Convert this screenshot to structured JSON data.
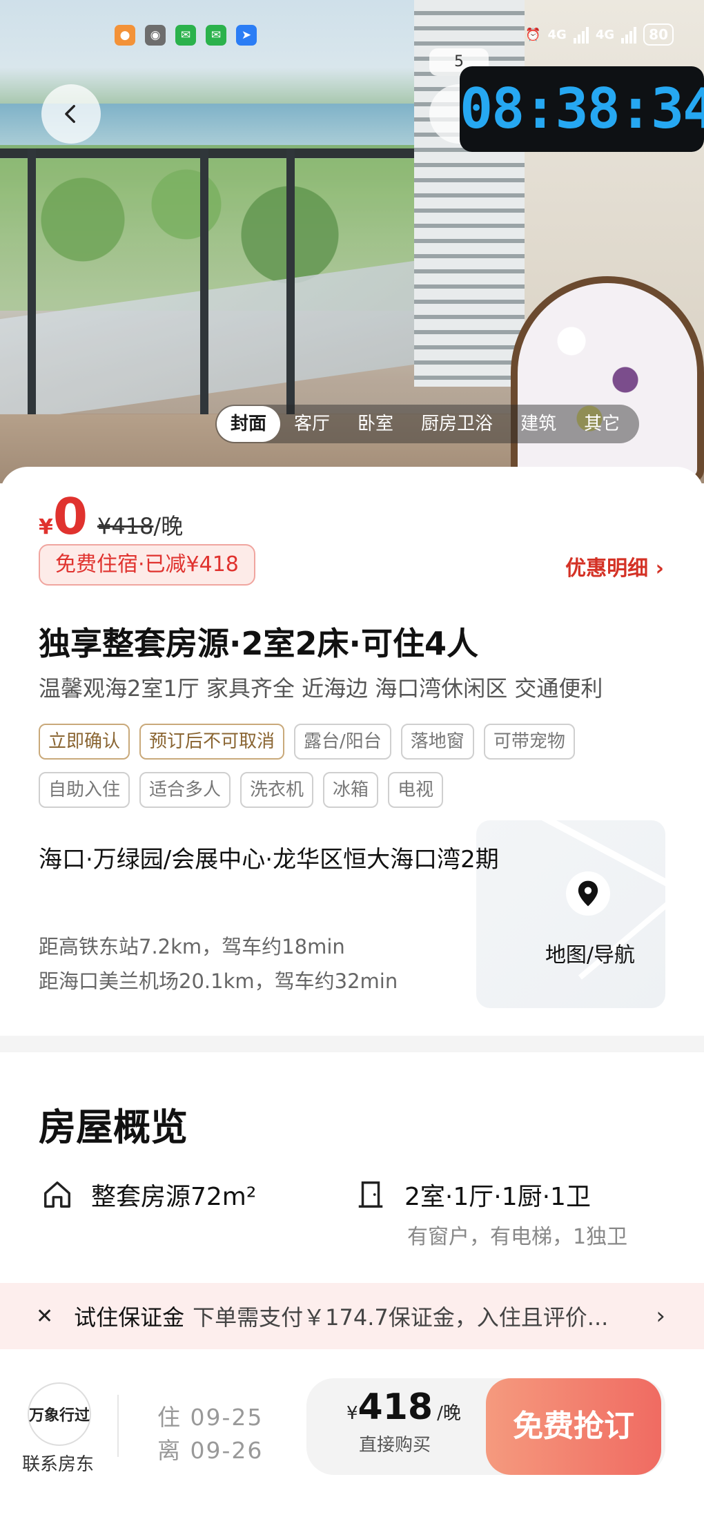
{
  "status_bar": {
    "apps": [
      {
        "name": "app-orange-icon",
        "color": "#f39238",
        "glyph": "●"
      },
      {
        "name": "camera-app-icon",
        "color": "#6d6d6d",
        "glyph": "◉"
      },
      {
        "name": "wechat-icon",
        "color": "#2bb24c",
        "glyph": "✉"
      },
      {
        "name": "wechat-icon-2",
        "color": "#2bb24c",
        "glyph": "✉"
      },
      {
        "name": "location-app-icon",
        "color": "#2b7df5",
        "glyph": "➤"
      }
    ],
    "network_1": "4G",
    "network_2": "4G",
    "battery": "80"
  },
  "hero": {
    "image_count": "5",
    "clock": "08:38:34",
    "photo_tabs": [
      "封面",
      "客厅",
      "卧室",
      "厨房卫浴",
      "建筑",
      "其它"
    ],
    "active_tab": "封面"
  },
  "price": {
    "currency": "¥",
    "current": "0",
    "original": "¥418",
    "unit": "/晚",
    "discount_badge": "免费住宿·已减¥418",
    "promo_detail": "优惠明细"
  },
  "listing": {
    "title": "独享整套房源·2室2床·可住4人",
    "subtitle": "温馨观海2室1厅 家具齐全 近海边 海口湾休闲区 交通便利",
    "tags_row1": [
      {
        "label": "立即确认",
        "style": "gold"
      },
      {
        "label": "预订后不可取消",
        "style": "gold"
      },
      {
        "label": "露台/阳台",
        "style": "gray"
      },
      {
        "label": "落地窗",
        "style": "gray"
      },
      {
        "label": "可带宠物",
        "style": "gray"
      }
    ],
    "tags_row2": [
      {
        "label": "自助入住",
        "style": "gray"
      },
      {
        "label": "适合多人",
        "style": "gray"
      },
      {
        "label": "洗衣机",
        "style": "gray"
      },
      {
        "label": "冰箱",
        "style": "gray"
      },
      {
        "label": "电视",
        "style": "gray"
      }
    ]
  },
  "location": {
    "address": "海口·万绿园/会展中心·龙华区恒大海口湾2期",
    "distance_1": "距高铁东站7.2km，驾车约18min",
    "distance_2": "距海口美兰机场20.1km，驾车约32min",
    "map_label": "地图/导航"
  },
  "overview": {
    "title": "房屋概览",
    "area": "整套房源72m²",
    "rooms": "2室·1厅·1厨·1卫",
    "rooms_sub": "有窗户，有电梯，1独卫"
  },
  "deposit": {
    "label": "试住保证金",
    "text": "下单需支付￥174.7保证金，入住且评价..."
  },
  "bottom": {
    "host_logo_text": "万象行过",
    "host_label": "联系房东",
    "checkin": "住 09-25",
    "checkout": "离 09-26",
    "buy_currency": "¥",
    "buy_price": "418",
    "buy_unit": "/晚",
    "buy_label": "直接购买",
    "grab_button": "免费抢订"
  },
  "colors": {
    "accent_red": "#e0322e",
    "grab_gradient_start": "#f59a7e",
    "grab_gradient_end": "#f06b62",
    "clock_digits": "#26a8f2"
  }
}
